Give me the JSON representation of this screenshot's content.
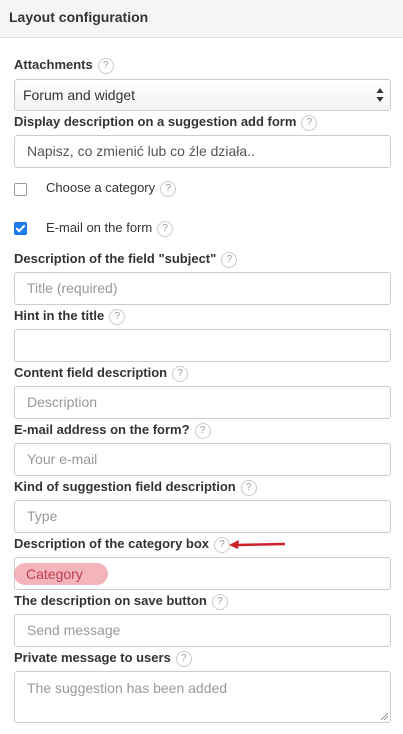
{
  "header": {
    "title": "Layout configuration"
  },
  "help_glyph": "?",
  "attachments": {
    "label": "Attachments",
    "value": "Forum and widget"
  },
  "display_description": {
    "label": "Display description on a suggestion add form",
    "value": "Napisz, co zmienić lub co źle działa.."
  },
  "choose_category": {
    "label": "Choose a category",
    "checked": false
  },
  "email_on_form": {
    "label": "E-mail on the form",
    "checked": true
  },
  "subject_description": {
    "label": "Description of the field \"subject\"",
    "placeholder": "Title (required)"
  },
  "hint_in_title": {
    "label": "Hint in the title",
    "value": ""
  },
  "content_description": {
    "label": "Content field description",
    "placeholder": "Description"
  },
  "email_address": {
    "label": "E-mail address on the form?",
    "placeholder": "Your e-mail"
  },
  "kind_description": {
    "label": "Kind of suggestion field description",
    "placeholder": "Type"
  },
  "category_box": {
    "label": "Description of the category box",
    "placeholder": "Category"
  },
  "save_button_description": {
    "label": "The description on save button",
    "placeholder": "Send message"
  },
  "private_message": {
    "label": "Private message to users",
    "placeholder": "The suggestion has been added"
  },
  "colors": {
    "accent": "#1e7cf0",
    "annotation_arrow": "#d0202a",
    "highlight": "#f2a7b0"
  }
}
